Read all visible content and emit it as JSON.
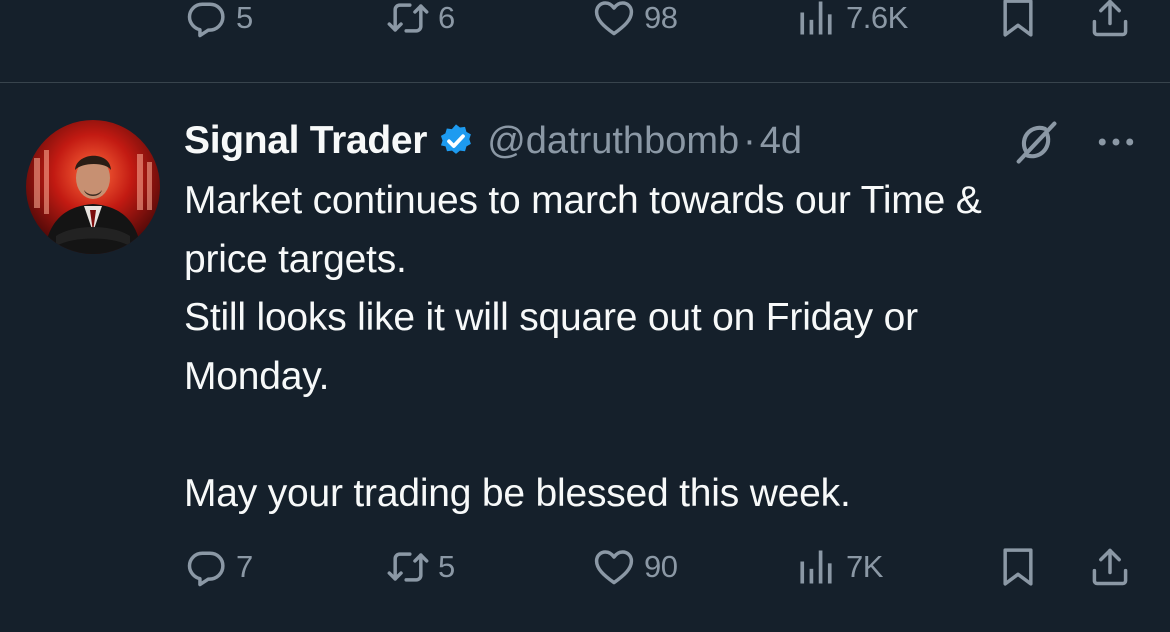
{
  "previous_tweet": {
    "actions": {
      "replies": "5",
      "retweets": "6",
      "likes": "98",
      "views": "7.6K"
    }
  },
  "tweet": {
    "display_name": "Signal Trader",
    "verified": true,
    "handle": "@datruthbomb",
    "separator": "·",
    "time": "4d",
    "lines": [
      "Market continues to march towards our Time &",
      "price targets.",
      "Still looks like it will square out on Friday or",
      "Monday.",
      "",
      "May your trading be blessed this week."
    ],
    "actions": {
      "replies": "7",
      "retweets": "5",
      "likes": "90",
      "views": "7K"
    }
  },
  "icons": {
    "reply": "speech-bubble-icon",
    "retweet": "retweet-arrows-icon",
    "like": "heart-icon",
    "views": "bar-chart-icon",
    "bookmark": "bookmark-icon",
    "share": "share-upload-icon",
    "grok": "grok-slash-icon",
    "more": "ellipsis-icon",
    "verified": "verified-badge-icon"
  },
  "colors": {
    "background": "#15202b",
    "text_primary": "#f7f9f9",
    "text_secondary": "#8b98a5",
    "divider": "#38444d",
    "verified_blue": "#1d9bf0"
  }
}
